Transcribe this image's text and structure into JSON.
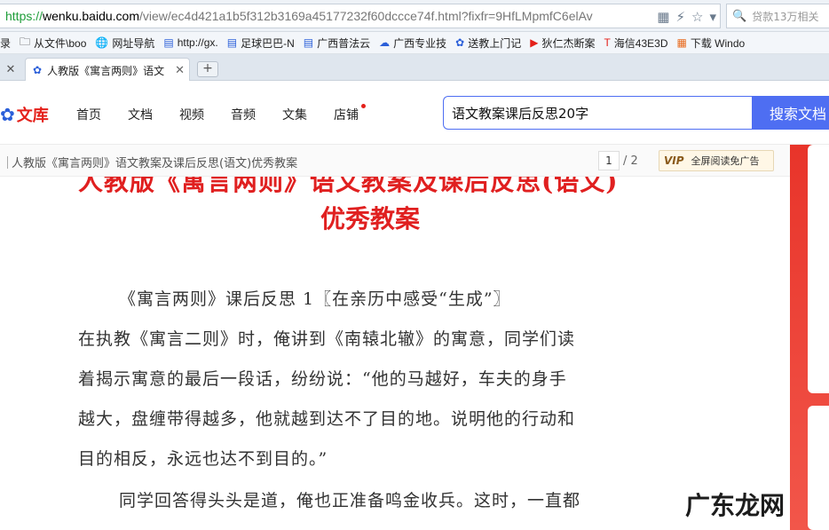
{
  "address_bar": {
    "url_scheme": "https://",
    "url_host": "wenku.baidu.com",
    "url_path": "/view/ec4d421a1b5f312b3169a45177232f60dccce74f.html?fixfr=9HfLMpmfC6elAv"
  },
  "browser_search": {
    "value": "贷款13万相关"
  },
  "bookmarks": [
    {
      "label": "录",
      "icon": "folder-icon"
    },
    {
      "label": "从文件\\boo",
      "icon": "folder-icon"
    },
    {
      "label": "网址导航",
      "icon": "globe-icon"
    },
    {
      "label": "http://gx.",
      "icon": "page-icon"
    },
    {
      "label": "足球巴巴-N",
      "icon": "page-icon"
    },
    {
      "label": "广西普法云",
      "icon": "page-icon"
    },
    {
      "label": "广西专业技",
      "icon": "cloud-icon"
    },
    {
      "label": "送教上门记",
      "icon": "paw-icon"
    },
    {
      "label": "狄仁杰断案",
      "icon": "play-icon"
    },
    {
      "label": "海信43E3D",
      "icon": "tmall-icon"
    },
    {
      "label": "下载 Windo",
      "icon": "windows-icon"
    }
  ],
  "tab": {
    "title": "人教版《寓言两则》语文"
  },
  "site": {
    "logo": "文库",
    "nav": [
      "首页",
      "文档",
      "视频",
      "音频",
      "文集",
      "店铺"
    ],
    "search_value": "语文教案课后反思20字",
    "search_button": "搜索文档"
  },
  "docbar": {
    "title": "人教版《寓言两则》语文教案及课后反思(语文)优秀教案",
    "page_current": "1",
    "page_total": "/ 2",
    "vip_badge": "VIP",
    "vip_text": "全屏阅读免广告"
  },
  "document": {
    "headline_partial": "人教版《寓言两则》语文教案及课后反思(语文)",
    "headline": "优秀教案",
    "lines": [
      "《寓言两则》课后反思 1〖在亲历中感受“生成”〗",
      "在执教《寓言二则》时，俺讲到《南辕北辙》的寓意，同学们读",
      "着揭示寓意的最后一段话，纷纷说：“他的马越好，车夫的身手",
      "越大，盘缠带得越多，他就越到达不了目的地。说明他的行动和",
      "目的相反，永远也达不到目的。”",
      "同学回答得头头是道，俺也正准备鸣金收兵。这时，一直都"
    ]
  },
  "watermark": "广东龙网"
}
